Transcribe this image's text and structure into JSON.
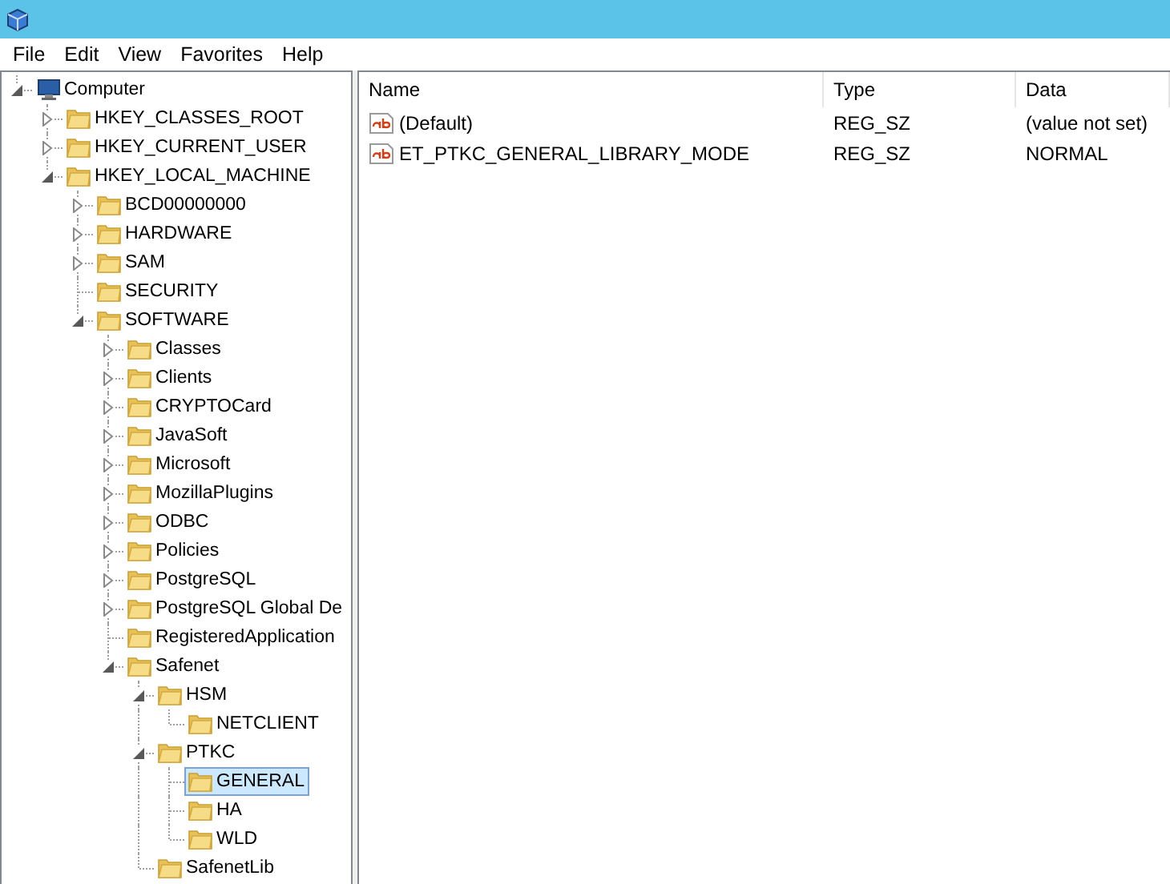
{
  "menu": [
    "File",
    "Edit",
    "View",
    "Favorites",
    "Help"
  ],
  "tree": [
    {
      "label": "Computer",
      "kind": "computer",
      "expanded": true,
      "selected": false,
      "children": [
        {
          "label": "HKEY_CLASSES_ROOT",
          "kind": "folder",
          "expanded": false,
          "selected": false
        },
        {
          "label": "HKEY_CURRENT_USER",
          "kind": "folder",
          "expanded": false,
          "selected": false
        },
        {
          "label": "HKEY_LOCAL_MACHINE",
          "kind": "folder",
          "expanded": true,
          "selected": false,
          "children": [
            {
              "label": "BCD00000000",
              "kind": "folder",
              "expanded": false,
              "selected": false
            },
            {
              "label": "HARDWARE",
              "kind": "folder",
              "expanded": false,
              "selected": false
            },
            {
              "label": "SAM",
              "kind": "folder",
              "expanded": false,
              "selected": false
            },
            {
              "label": "SECURITY",
              "kind": "folder",
              "selected": false
            },
            {
              "label": "SOFTWARE",
              "kind": "folder",
              "expanded": true,
              "selected": false,
              "children": [
                {
                  "label": "Classes",
                  "kind": "folder",
                  "expanded": false,
                  "selected": false
                },
                {
                  "label": "Clients",
                  "kind": "folder",
                  "expanded": false,
                  "selected": false
                },
                {
                  "label": "CRYPTOCard",
                  "kind": "folder",
                  "expanded": false,
                  "selected": false
                },
                {
                  "label": "JavaSoft",
                  "kind": "folder",
                  "expanded": false,
                  "selected": false
                },
                {
                  "label": "Microsoft",
                  "kind": "folder",
                  "expanded": false,
                  "selected": false
                },
                {
                  "label": "MozillaPlugins",
                  "kind": "folder",
                  "expanded": false,
                  "selected": false
                },
                {
                  "label": "ODBC",
                  "kind": "folder",
                  "expanded": false,
                  "selected": false
                },
                {
                  "label": "Policies",
                  "kind": "folder",
                  "expanded": false,
                  "selected": false
                },
                {
                  "label": "PostgreSQL",
                  "kind": "folder",
                  "expanded": false,
                  "selected": false
                },
                {
                  "label": "PostgreSQL Global De",
                  "kind": "folder",
                  "expanded": false,
                  "selected": false
                },
                {
                  "label": "RegisteredApplication",
                  "kind": "folder",
                  "selected": false
                },
                {
                  "label": "Safenet",
                  "kind": "folder",
                  "expanded": true,
                  "selected": false,
                  "children": [
                    {
                      "label": "HSM",
                      "kind": "folder",
                      "expanded": true,
                      "selected": false,
                      "children": [
                        {
                          "label": "NETCLIENT",
                          "kind": "folder",
                          "selected": false
                        }
                      ]
                    },
                    {
                      "label": "PTKC",
                      "kind": "folder",
                      "expanded": true,
                      "selected": false,
                      "children": [
                        {
                          "label": "GENERAL",
                          "kind": "folder",
                          "selected": true
                        },
                        {
                          "label": "HA",
                          "kind": "folder",
                          "selected": false
                        },
                        {
                          "label": "WLD",
                          "kind": "folder",
                          "selected": false
                        }
                      ]
                    },
                    {
                      "label": "SafenetLib",
                      "kind": "folder",
                      "selected": false
                    }
                  ]
                }
              ]
            }
          ]
        }
      ]
    }
  ],
  "table": {
    "columns": [
      "Name",
      "Type",
      "Data"
    ],
    "rows": [
      {
        "name": "(Default)",
        "type": "REG_SZ",
        "data": "(value not set)"
      },
      {
        "name": "ET_PTKC_GENERAL_LIBRARY_MODE",
        "type": "REG_SZ",
        "data": "NORMAL"
      }
    ]
  }
}
